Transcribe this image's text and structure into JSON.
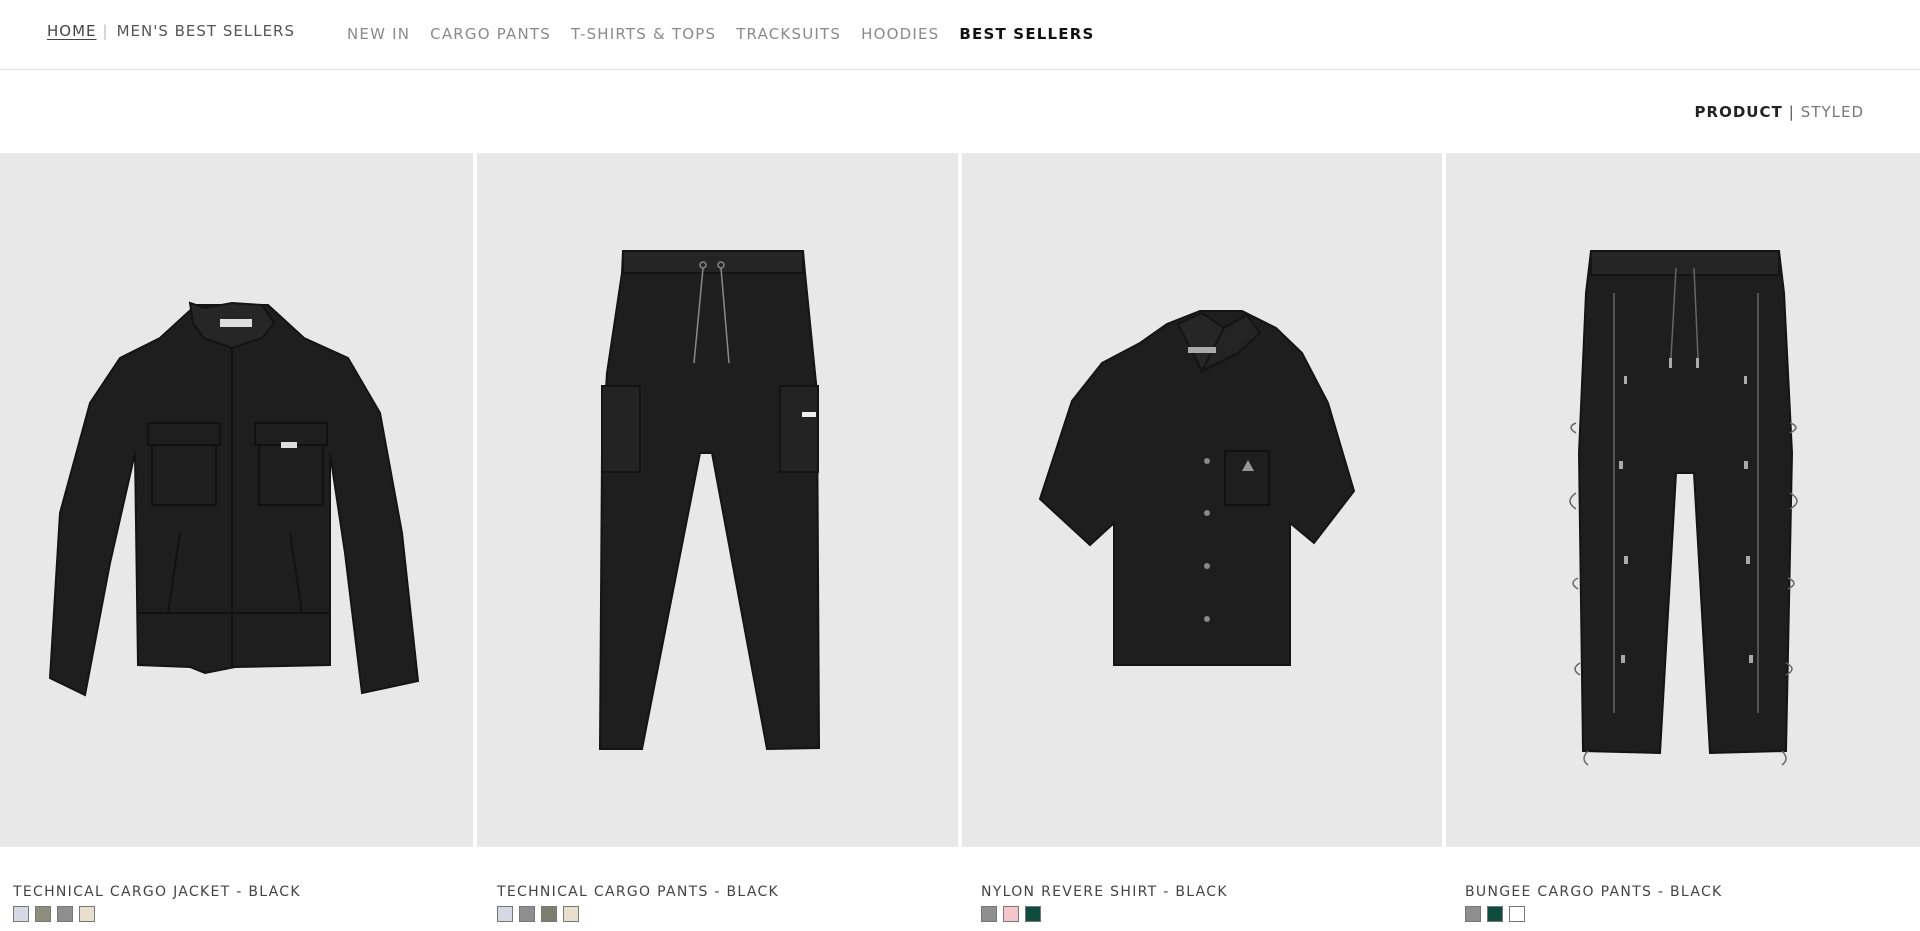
{
  "breadcrumb": {
    "home": "HOME",
    "separator": "|",
    "current": "MEN'S BEST SELLERS"
  },
  "nav": {
    "items": [
      {
        "label": "NEW IN",
        "active": false
      },
      {
        "label": "CARGO PANTS",
        "active": false
      },
      {
        "label": "T-SHIRTS & TOPS",
        "active": false
      },
      {
        "label": "TRACKSUITS",
        "active": false
      },
      {
        "label": "HOODIES",
        "active": false
      },
      {
        "label": "BEST SELLERS",
        "active": true
      }
    ]
  },
  "view_toggle": {
    "product": "PRODUCT",
    "separator": "|",
    "styled": "STYLED",
    "selected": "PRODUCT"
  },
  "products": [
    {
      "name": "TECHNICAL CARGO JACKET - BLACK",
      "image": "cargo-jacket",
      "swatches": [
        "#d6d9e4",
        "#8d8f7c",
        "#8f8f8f",
        "#e8dfcf"
      ]
    },
    {
      "name": "TECHNICAL CARGO PANTS - BLACK",
      "image": "cargo-pants",
      "swatches": [
        "#d6d9e4",
        "#8f8f8f",
        "#7c7f6f",
        "#e8dfcf"
      ]
    },
    {
      "name": "NYLON REVERE SHIRT - BLACK",
      "image": "revere-shirt",
      "swatches": [
        "#8f8f8f",
        "#f4c6cb",
        "#0f4c3f"
      ]
    },
    {
      "name": "BUNGEE CARGO PANTS - BLACK",
      "image": "bungee-pants",
      "swatches": [
        "#8f8f8f",
        "#0f4c3f",
        "#ffffff"
      ]
    }
  ],
  "colors": {
    "tile_background": "#e8e8e8",
    "garment": "#1e1e1e",
    "active_text": "#111111",
    "muted_text": "#8a8a8a"
  }
}
